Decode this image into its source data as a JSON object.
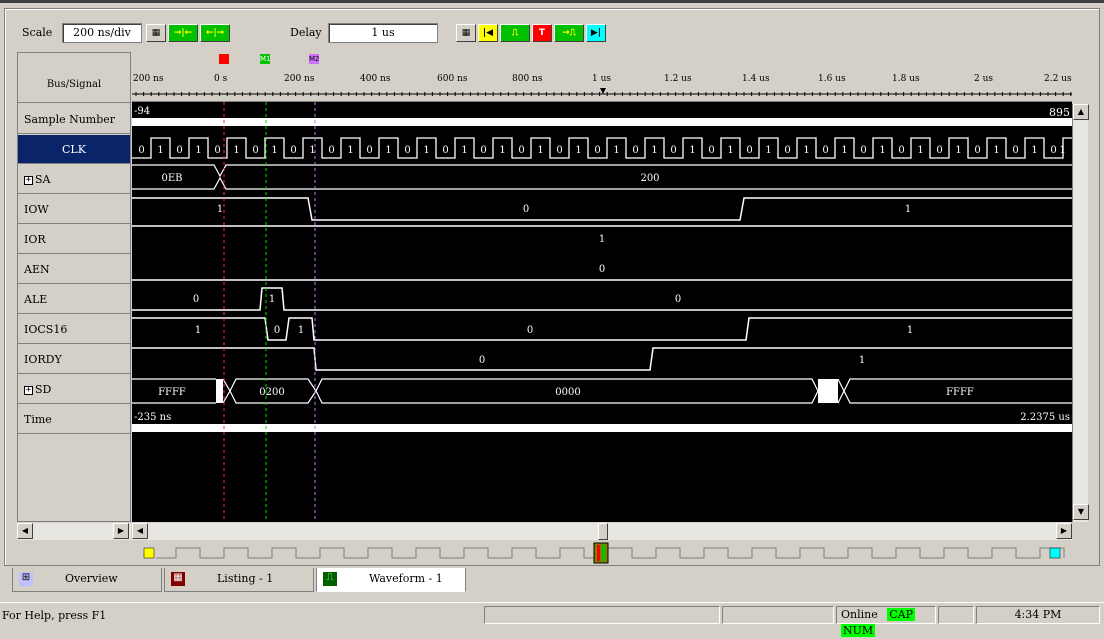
{
  "toolbar": {
    "scale_label": "Scale",
    "scale_value": "200 ns/div",
    "delay_label": "Delay",
    "delay_value": "1 us"
  },
  "header": {
    "bus_signal": "Bus/Signal"
  },
  "ruler": {
    "ticks": [
      "200 ns",
      "0 s",
      "200 ns",
      "400 ns",
      "600 ns",
      "800 ns",
      "1 us",
      "1.2 us",
      "1.4 us",
      "1.6 us",
      "1.8 us",
      "2 us",
      "2.2 us"
    ],
    "markers": [
      "M1",
      "M2"
    ]
  },
  "signals": [
    {
      "name": "Sample Number"
    },
    {
      "name": "CLK"
    },
    {
      "name": "SA",
      "expandable": true
    },
    {
      "name": "IOW"
    },
    {
      "name": "IOR"
    },
    {
      "name": "AEN"
    },
    {
      "name": "ALE"
    },
    {
      "name": "IOCS16"
    },
    {
      "name": "IORDY"
    },
    {
      "name": "SD",
      "expandable": true
    },
    {
      "name": "Time"
    }
  ],
  "sample_number": {
    "start": "-94",
    "end": "895"
  },
  "time": {
    "start": "-235 ns",
    "end": "2.2375 us"
  },
  "waves": {
    "clk": [
      "0",
      "1",
      "0",
      "1",
      "0",
      "1",
      "0",
      "1",
      "0",
      "1",
      "0",
      "1",
      "0",
      "1",
      "0",
      "1",
      "0",
      "1",
      "0",
      "1",
      "0",
      "1",
      "0",
      "1",
      "0",
      "1",
      "0",
      "1",
      "0",
      "1",
      "0",
      "1",
      "0",
      "1",
      "0",
      "1",
      "0",
      "1",
      "0",
      "1",
      "0",
      "1",
      "0",
      "1",
      "0",
      "1",
      "0",
      "1",
      "0",
      "1"
    ],
    "sa": [
      "0EB",
      "200"
    ],
    "iow": [
      "1",
      "0",
      "1"
    ],
    "ior": [
      "1"
    ],
    "aen": [
      "0"
    ],
    "ale": [
      "0",
      "1",
      "0"
    ],
    "iocs16": [
      "1",
      "0",
      "1",
      "0",
      "1"
    ],
    "iordy": [
      "0",
      "1"
    ],
    "sd": [
      "FFFF",
      "0200",
      "0000",
      "FFFF"
    ]
  },
  "tabs": [
    {
      "label": "Overview",
      "icon": "overview-icon"
    },
    {
      "label": "Listing - 1",
      "icon": "listing-icon"
    },
    {
      "label": "Waveform - 1",
      "icon": "waveform-icon"
    }
  ],
  "status": {
    "help": "For Help, press F1",
    "online": "Online",
    "cap": "CAP",
    "num": "NUM",
    "time": "4:34 PM"
  },
  "colors": {
    "selection": "#0a246a",
    "trigger_red": "#ff0000",
    "m1_green": "#00c000",
    "m2_violet": "#d070ff",
    "status_green": "#00ff00"
  }
}
